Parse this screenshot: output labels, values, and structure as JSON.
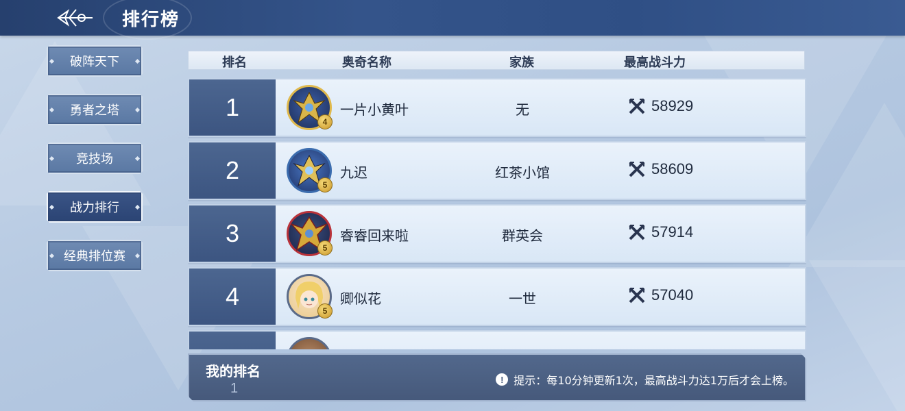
{
  "header": {
    "title": "排行榜",
    "back_icon": "back-arrow-icon"
  },
  "sidebar": {
    "items": [
      {
        "label": "破阵天下",
        "active": false
      },
      {
        "label": "勇者之塔",
        "active": false
      },
      {
        "label": "竞技场",
        "active": false
      },
      {
        "label": "战力排行",
        "active": true
      },
      {
        "label": "经典排位赛",
        "active": false
      }
    ]
  },
  "table": {
    "headers": {
      "rank": "排名",
      "name": "奥奇名称",
      "family": "家族",
      "power": "最高战斗力"
    },
    "rows": [
      {
        "rank": "1",
        "name": "一片小黄叶",
        "family": "无",
        "power": "58929",
        "stars": "4",
        "avatar": "dragon-avatar-gold"
      },
      {
        "rank": "2",
        "name": "九迟",
        "family": "红茶小馆",
        "power": "58609",
        "stars": "5",
        "avatar": "dragon-avatar-blue"
      },
      {
        "rank": "3",
        "name": "睿睿回来啦",
        "family": "群英会",
        "power": "57914",
        "stars": "5",
        "avatar": "dragon-avatar-gold-red"
      },
      {
        "rank": "4",
        "name": "卿似花",
        "family": "一世",
        "power": "57040",
        "stars": "5",
        "avatar": "girl-avatar-blonde"
      }
    ]
  },
  "my_rank": {
    "label": "我的排名",
    "value": "1",
    "tip": "提示：每10分钟更新1次，最高战斗力达1万后才会上榜。"
  },
  "colors": {
    "topbar": "#2f4f85",
    "rank_cell": "#4c6690",
    "active_tab": "#2b4474"
  }
}
